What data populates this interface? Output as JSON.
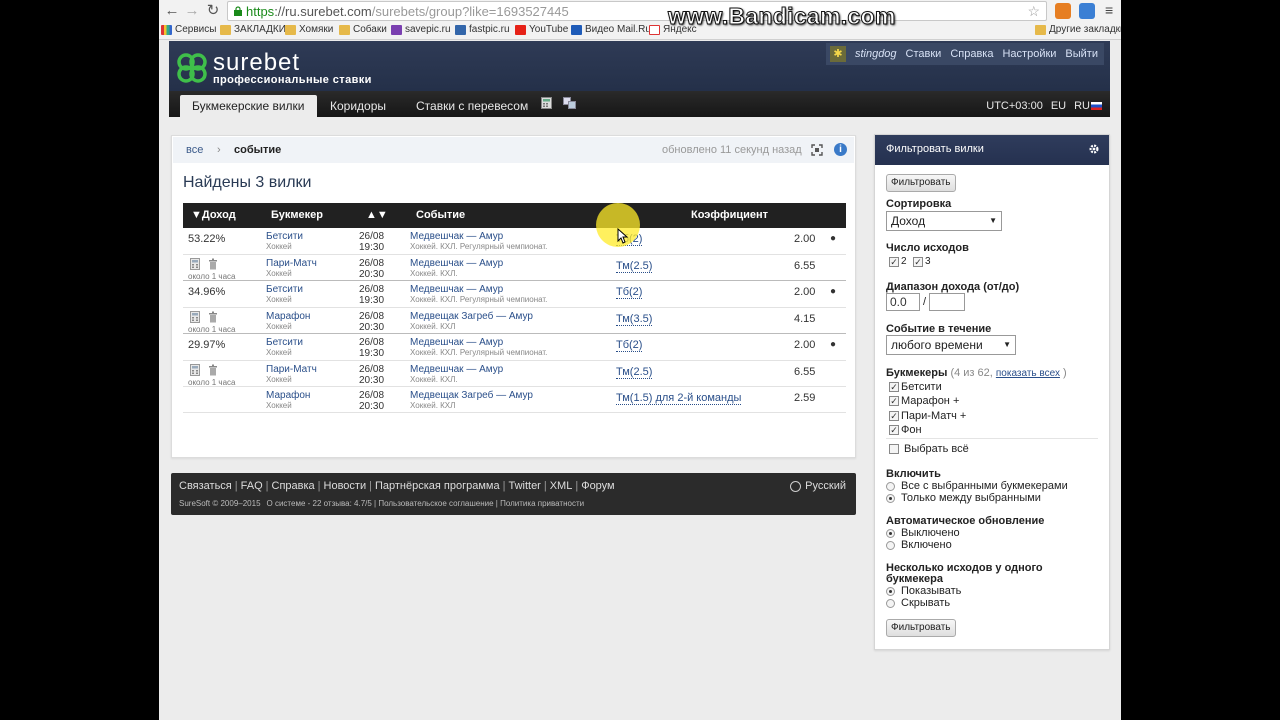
{
  "browser": {
    "url_scheme": "https",
    "url_host": "://ru.surebet.com",
    "url_path": "/surebets/group?like=1693527445",
    "bookmarks": [
      "Сервисы",
      "ЗАКЛАДКИ",
      "Хомяки",
      "Собаки",
      "savepic.ru",
      "fastpic.ru",
      "YouTube",
      "Видео Mail.Ru",
      "Яндекс"
    ],
    "other_bookmarks": "Другие закладки",
    "watermark": "www.Bandicam.com"
  },
  "site": {
    "logo_name": "surebet",
    "logo_tagline": "профессиональные ставки",
    "username": "stingdog",
    "user_menu": [
      "Ставки",
      "Справка",
      "Настройки",
      "Выйти"
    ],
    "tabs": [
      "Букмекерские вилки",
      "Коридоры",
      "Ставки с перевесом"
    ],
    "timezone": "UTC+03:00",
    "region": "EU",
    "language": "RU"
  },
  "main": {
    "crumb_all": "все",
    "crumb_sep": "›",
    "crumb_current": "событие",
    "updated": "обновлено 11 секунд назад",
    "found_title": "Найдены 3 вилки",
    "columns": {
      "profit": "▼Доход",
      "bookmaker": "Букмекер",
      "sort": "▲▼",
      "event": "Событие",
      "coef": "Коэффициент"
    },
    "groups": [
      {
        "profit": "53.22%",
        "age": "около 1 часа",
        "rows": [
          {
            "bookmaker": "Бетсити",
            "sport": "Хоккей",
            "date": "26/08",
            "time": "19:30",
            "event": "Медвешчак — Амур",
            "league": "Хоккей. КХЛ. Регулярный чемпионат.",
            "market": "Тб(2)",
            "coef": "2.00",
            "dot": "●"
          },
          {
            "bookmaker": "Пари-Матч",
            "sport": "Хоккей",
            "date": "26/08",
            "time": "20:30",
            "event": "Медвешчак — Амур",
            "league": "Хоккей. КХЛ.",
            "market": "Тм(2.5)",
            "coef": "6.55",
            "dot": ""
          }
        ]
      },
      {
        "profit": "34.96%",
        "age": "около 1 часа",
        "rows": [
          {
            "bookmaker": "Бетсити",
            "sport": "Хоккей",
            "date": "26/08",
            "time": "19:30",
            "event": "Медвешчак — Амур",
            "league": "Хоккей. КХЛ. Регулярный чемпионат.",
            "market": "Тб(2)",
            "coef": "2.00",
            "dot": "●"
          },
          {
            "bookmaker": "Марафон",
            "sport": "Хоккей",
            "date": "26/08",
            "time": "20:30",
            "event": "Медвещак Загреб — Амур",
            "league": "Хоккей. КХЛ",
            "market": "Тм(3.5)",
            "coef": "4.15",
            "dot": ""
          }
        ]
      },
      {
        "profit": "29.97%",
        "age": "около 1 часа",
        "rows": [
          {
            "bookmaker": "Бетсити",
            "sport": "Хоккей",
            "date": "26/08",
            "time": "19:30",
            "event": "Медвешчак — Амур",
            "league": "Хоккей. КХЛ. Регулярный чемпионат.",
            "market": "Тб(2)",
            "coef": "2.00",
            "dot": "●"
          },
          {
            "bookmaker": "Пари-Матч",
            "sport": "Хоккей",
            "date": "26/08",
            "time": "20:30",
            "event": "Медвешчак — Амур",
            "league": "Хоккей. КХЛ.",
            "market": "Тм(2.5)",
            "coef": "6.55",
            "dot": ""
          },
          {
            "bookmaker": "Марафон",
            "sport": "Хоккей",
            "date": "26/08",
            "time": "20:30",
            "event": "Медвещак Загреб — Амур",
            "league": "Хоккей. КХЛ",
            "market": "Тм(1.5) для 2-й команды",
            "coef": "2.59",
            "dot": ""
          }
        ]
      }
    ]
  },
  "footer": {
    "links": [
      "Связаться",
      "FAQ",
      "Справка",
      "Новости",
      "Партнёрская программа",
      "Twitter",
      "XML",
      "Форум"
    ],
    "copyright": "SureSoft © 2009–2015",
    "small_links": "О системе - 22 отзыва: 4.7/5 | Пользовательское соглашение | Политика приватности",
    "language": "Русский"
  },
  "filter": {
    "title": "Фильтровать вилки",
    "button": "Фильтровать",
    "sort_label": "Сортировка",
    "sort_value": "Доход",
    "outcomes_label": "Число исходов",
    "outcomes": [
      "2",
      "3"
    ],
    "range_label": "Диапазон дохода (от/до)",
    "range_from": "0.0",
    "range_sep": "/",
    "range_to": "",
    "period_label": "Событие в течение",
    "period_value": "любого времени",
    "bookmakers_label": "Букмекеры",
    "bookmakers_count": "(4 из 62,",
    "show_all": "показать всех",
    "bookmakers_close": ")",
    "bookmakers": [
      "Бетсити",
      "Марафон +",
      "Пари-Матч +",
      "Фон"
    ],
    "select_all": "Выбрать всё",
    "include_label": "Включить",
    "include_options": [
      "Все с выбранными букмекерами",
      "Только между выбранными"
    ],
    "auto_label": "Автоматическое обновление",
    "auto_options": [
      "Выключено",
      "Включено"
    ],
    "multi_label_1": "Несколько исходов у одного",
    "multi_label_2": "букмекера",
    "multi_options": [
      "Показывать",
      "Скрывать"
    ]
  }
}
